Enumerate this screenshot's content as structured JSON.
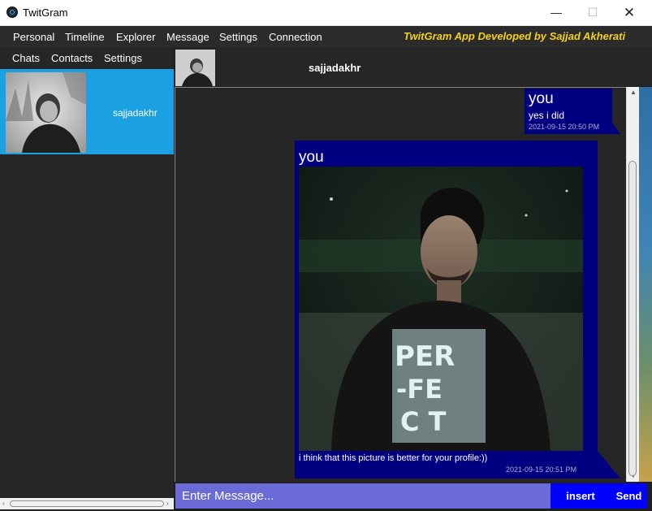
{
  "window": {
    "title": "TwitGram",
    "minimize": "—",
    "maximize": "☐",
    "close": "✕"
  },
  "menu": {
    "items": [
      "Personal",
      "Timeline",
      "Explorer",
      "Message",
      "Settings",
      "Connection"
    ],
    "credit": "TwitGram App Developed by Sajjad Akherati"
  },
  "left_nav": {
    "items": [
      "Chats",
      "Contacts",
      "Settings"
    ]
  },
  "chats": [
    {
      "name": "sajjadakhr"
    }
  ],
  "conversation": {
    "contact": "sajjadakhr",
    "messages": [
      {
        "sender": "you",
        "text": "yes i did",
        "time": "2021-09-15 20:50 PM"
      },
      {
        "sender": "you",
        "text": "i think that this picture is better for your profile:))",
        "time": "2021-09-15 20:51 PM"
      }
    ]
  },
  "composer": {
    "placeholder": "Enter Message...",
    "insert_label": "insert",
    "send_label": "Send"
  },
  "colors": {
    "accent_blue": "#1ba1e2",
    "bubble": "#000080",
    "input": "#6b6bd8",
    "button": "#0000ff",
    "credit": "#f5d020"
  }
}
